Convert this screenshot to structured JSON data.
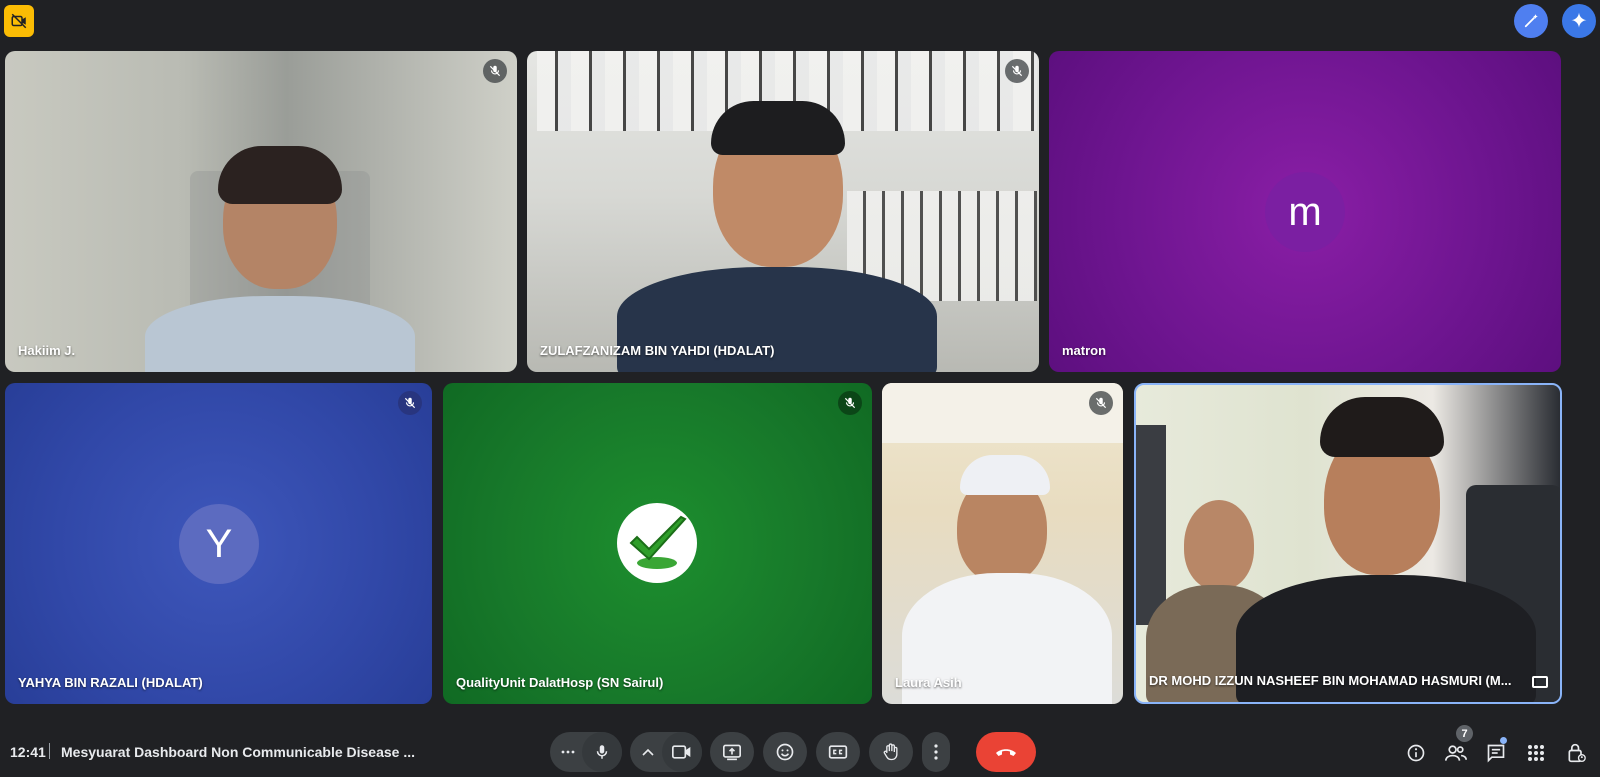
{
  "meeting": {
    "time": "12:41",
    "title": "Mesyuarat Dashboard Non Communicable Disease ..."
  },
  "participants": [
    {
      "name": "Hakiim J.",
      "muted": true,
      "type": "video"
    },
    {
      "name": "ZULAFZANIZAM BIN YAHDI (HDALAT)",
      "muted": true,
      "type": "video"
    },
    {
      "name": "matron",
      "muted": false,
      "type": "avatar",
      "initial": "m",
      "color": "#7b1fa2"
    },
    {
      "name": "YAHYA BIN RAZALI (HDALAT)",
      "muted": true,
      "type": "avatar",
      "initial": "Y",
      "color": "#5c6bc0"
    },
    {
      "name": "QualityUnit DalatHosp (SN Sairul)",
      "muted": true,
      "type": "logo"
    },
    {
      "name": "Laura Asih",
      "muted": true,
      "type": "video"
    },
    {
      "name": "DR MOHD IZZUN NASHEEF BIN MOHAMAD HASMURI (M...",
      "muted": false,
      "type": "video",
      "active_speaker": true
    }
  ],
  "people_count": "7",
  "colors": {
    "background": "#202124",
    "end_call": "#ea4335",
    "control": "#3c4043",
    "accent_blue": "#8ab4f8"
  },
  "icons": {
    "camera_off": "camera-off-icon",
    "mic_off": "mic-off-icon",
    "more_options": "more-options-icon",
    "info": "info-icon",
    "people": "people-icon",
    "chat": "chat-icon",
    "activities": "apps-icon",
    "host_controls": "lock-person-icon"
  }
}
